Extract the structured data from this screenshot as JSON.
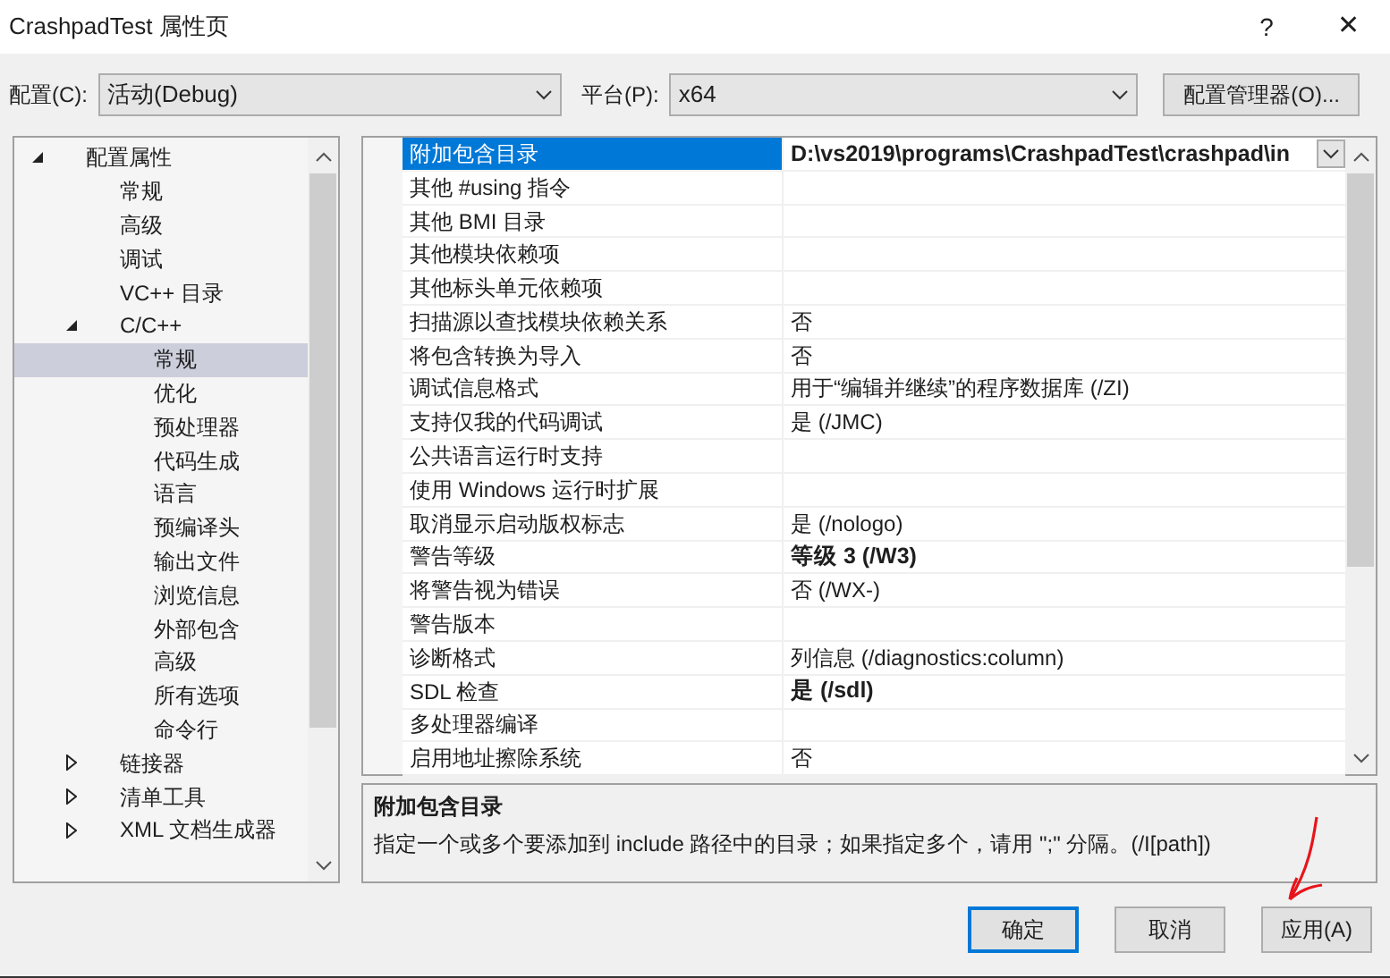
{
  "window": {
    "title": "CrashpadTest 属性页",
    "help": "?",
    "close": "✕"
  },
  "toolbar": {
    "config_label": "配置(C):",
    "config_value": "活动(Debug)",
    "platform_label": "平台(P):",
    "platform_value": "x64",
    "manager_button": "配置管理器(O)..."
  },
  "tree": [
    {
      "label": "配置属性",
      "expanded": true,
      "selected": false,
      "children": [
        {
          "label": "常规",
          "selected": false
        },
        {
          "label": "高级",
          "selected": false
        },
        {
          "label": "调试",
          "selected": false
        },
        {
          "label": "VC++ 目录",
          "selected": false
        },
        {
          "label": "C/C++",
          "expanded": true,
          "selected": false,
          "children": [
            {
              "label": "常规",
              "selected": true
            },
            {
              "label": "优化",
              "selected": false
            },
            {
              "label": "预处理器",
              "selected": false
            },
            {
              "label": "代码生成",
              "selected": false
            },
            {
              "label": "语言",
              "selected": false
            },
            {
              "label": "预编译头",
              "selected": false
            },
            {
              "label": "输出文件",
              "selected": false
            },
            {
              "label": "浏览信息",
              "selected": false
            },
            {
              "label": "外部包含",
              "selected": false
            },
            {
              "label": "高级",
              "selected": false
            },
            {
              "label": "所有选项",
              "selected": false
            },
            {
              "label": "命令行",
              "selected": false
            }
          ]
        },
        {
          "label": "链接器",
          "expanded": false,
          "selected": false
        },
        {
          "label": "清单工具",
          "expanded": false,
          "selected": false
        },
        {
          "label": "XML 文档生成器",
          "expanded": false,
          "selected": false
        }
      ]
    }
  ],
  "properties": [
    {
      "name": "附加包含目录",
      "value": "D:\\vs2019\\programs\\CrashpadTest\\crashpad\\in",
      "bold": true,
      "selected": true
    },
    {
      "name": "其他 #using 指令",
      "selected": false
    },
    {
      "name": "其他 BMI 目录",
      "selected": false
    },
    {
      "name": "其他模块依赖项",
      "selected": false
    },
    {
      "name": "其他标头单元依赖项",
      "selected": false
    },
    {
      "name": "扫描源以查找模块依赖关系",
      "value": "否",
      "bold": false,
      "selected": false
    },
    {
      "name": "将包含转换为导入",
      "value": "否",
      "bold": false,
      "selected": false
    },
    {
      "name": "调试信息格式",
      "value": "用于“编辑并继续”的程序数据库 (/ZI)",
      "bold": false,
      "selected": false
    },
    {
      "name": "支持仅我的代码调试",
      "value": "是 (/JMC)",
      "bold": false,
      "selected": false
    },
    {
      "name": "公共语言运行时支持",
      "selected": false
    },
    {
      "name": "使用 Windows 运行时扩展",
      "selected": false
    },
    {
      "name": "取消显示启动版权标志",
      "value": "是 (/nologo)",
      "bold": false,
      "selected": false
    },
    {
      "name": "警告等级",
      "value": "等级 3 (/W3)",
      "bold": true,
      "selected": false
    },
    {
      "name": "将警告视为错误",
      "value": "否 (/WX-)",
      "bold": false,
      "selected": false
    },
    {
      "name": "警告版本",
      "selected": false
    },
    {
      "name": "诊断格式",
      "value": "列信息 (/diagnostics:column)",
      "bold": false,
      "selected": false
    },
    {
      "name": "SDL 检查",
      "value": "是 (/sdl)",
      "bold": true,
      "selected": false
    },
    {
      "name": "多处理器编译",
      "selected": false
    },
    {
      "name": "启用地址擦除系统",
      "value": "否",
      "bold": false,
      "selected": false
    }
  ],
  "description": {
    "title": "附加包含目录",
    "text": "指定一个或多个要添加到 include 路径中的目录；如果指定多个，请用 \";\" 分隔。(/I[path])"
  },
  "buttons": [
    {
      "label": "确定",
      "default": true
    },
    {
      "label": "取消",
      "default": false
    },
    {
      "label": "应用(A)",
      "default": false
    }
  ]
}
